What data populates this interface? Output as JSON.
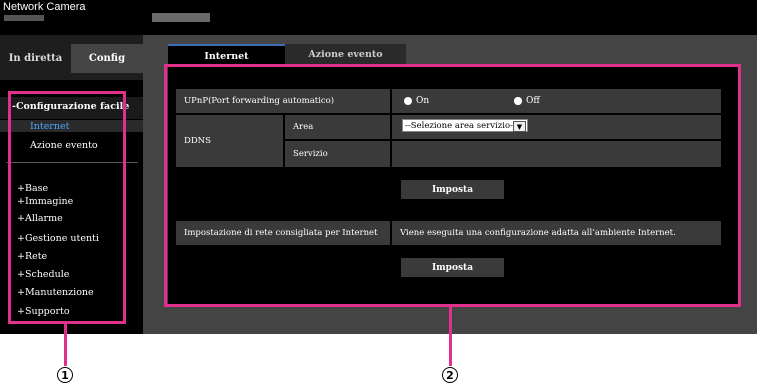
{
  "header": {
    "brand": "Network Camera"
  },
  "sidebar": {
    "tabs": [
      "In diretta",
      "Config"
    ],
    "section_title": "-Configurazione facile",
    "sub_items": [
      "Internet",
      "Azione evento"
    ],
    "items": [
      "+Base",
      "+Immagine",
      "+Allarme",
      "+Gestione utenti",
      "+Rete",
      "+Schedule",
      "+Manutenzione",
      "+Supporto"
    ]
  },
  "main": {
    "tabs": [
      "Internet",
      "Azione evento"
    ],
    "upnp": {
      "label": "UPnP(Port forwarding automatico)",
      "on_label": "On",
      "off_label": "Off"
    },
    "ddns": {
      "label": "DDNS",
      "area_label": "Area",
      "area_value": "--Selezione area servizio--",
      "servizio_label": "Servizio"
    },
    "imposta_label": "Imposta",
    "recommended": {
      "label": "Impostazione di rete consigliata per Internet",
      "description": "Viene eseguita una configurazione adatta all’ambiente Internet."
    }
  },
  "callouts": [
    "1",
    "2"
  ],
  "colors": {
    "highlight": "#e0308c",
    "tab_accent": "#3a6fb5"
  }
}
